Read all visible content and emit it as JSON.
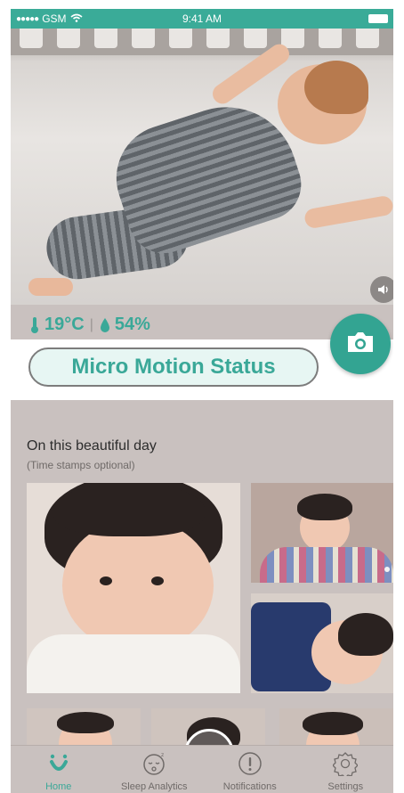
{
  "status_bar": {
    "carrier": "GSM",
    "time": "9:41 AM"
  },
  "environment": {
    "temperature": "19°C",
    "humidity": "54%"
  },
  "status_pill": {
    "label": "Micro Motion Status"
  },
  "day_section": {
    "title": "On this beautiful day",
    "subtitle": "(Time stamps optional)"
  },
  "tabs": [
    {
      "label": "Home",
      "icon": "home-icon",
      "active": true
    },
    {
      "label": "Sleep Analytics",
      "icon": "sleep-face-icon",
      "active": false
    },
    {
      "label": "Notifications",
      "icon": "exclamation-icon",
      "active": false
    },
    {
      "label": "Settings",
      "icon": "gear-icon",
      "active": false
    }
  ],
  "colors": {
    "accent": "#3aa898",
    "background": "#c9c1bf",
    "status_bar": "#3aab98"
  }
}
